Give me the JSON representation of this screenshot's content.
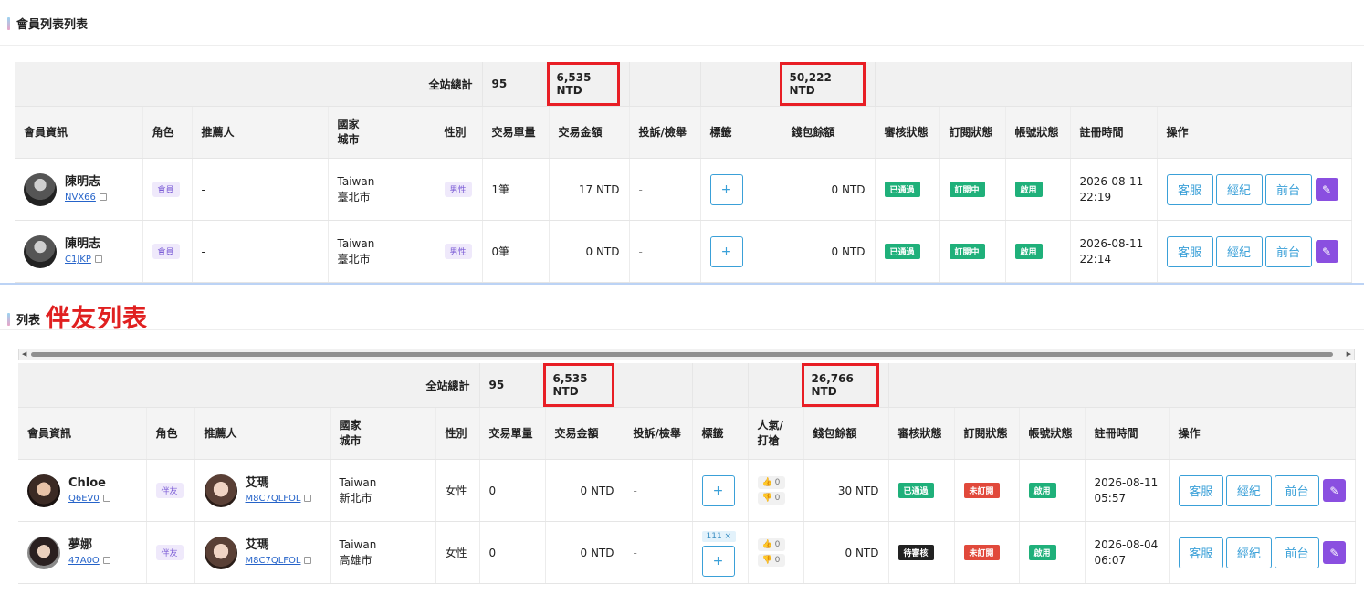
{
  "top_panel": {
    "title": "會員列表列表",
    "summary": {
      "label": "全站總計",
      "count": "95",
      "amount": "6,535 NTD",
      "wallet": "50,222 NTD"
    },
    "headers": {
      "member": "會員資訊",
      "role": "角色",
      "referrer": "推薦人",
      "country": "國家",
      "city": "城市",
      "gender": "性別",
      "tx_count": "交易單量",
      "tx_amount": "交易金額",
      "complaint": "投訴/檢舉",
      "tags": "標籤",
      "wallet": "錢包餘額",
      "review": "審核狀態",
      "subscription": "訂閱狀態",
      "account": "帳號狀態",
      "registered": "註冊時間",
      "actions": "操作"
    },
    "rows": [
      {
        "name": "陳明志",
        "code": "NVX66",
        "role": "會員",
        "referrer": "-",
        "country": "Taiwan",
        "city": "臺北市",
        "gender": "男性",
        "tx_count": "1筆",
        "tx_amount": "17 NTD",
        "complaint": "-",
        "wallet": "0 NTD",
        "review": "已通過",
        "subscription": "訂閱中",
        "account": "啟用",
        "date": "2026-08-11",
        "time": "22:19"
      },
      {
        "name": "陳明志",
        "code": "C1JKP",
        "role": "會員",
        "referrer": "-",
        "country": "Taiwan",
        "city": "臺北市",
        "gender": "男性",
        "tx_count": "0筆",
        "tx_amount": "0 NTD",
        "complaint": "-",
        "wallet": "0 NTD",
        "review": "已通過",
        "subscription": "訂閱中",
        "account": "啟用",
        "date": "2026-08-11",
        "time": "22:14"
      }
    ]
  },
  "bottom_panel": {
    "title": "列表",
    "big_title": "伴友列表",
    "summary": {
      "label": "全站總計",
      "count": "95",
      "amount": "6,535 NTD",
      "wallet": "26,766 NTD"
    },
    "headers": {
      "member": "會員資訊",
      "role": "角色",
      "referrer": "推薦人",
      "country": "國家",
      "city": "城市",
      "gender": "性別",
      "tx_count": "交易單量",
      "tx_amount": "交易金額",
      "complaint": "投訴/檢舉",
      "tags": "標籤",
      "popularity": "人氣/",
      "popularity2": "打槍",
      "wallet": "錢包餘額",
      "review": "審核狀態",
      "subscription": "訂閱狀態",
      "account": "帳號狀態",
      "registered": "註冊時間",
      "actions": "操作"
    },
    "rows": [
      {
        "name": "Chloe",
        "code": "Q6EV0",
        "role": "伴友",
        "ref_name": "艾瑪",
        "ref_code": "M8C7QLFOL",
        "country": "Taiwan",
        "city": "新北市",
        "gender": "女性",
        "tx_count": "0",
        "tx_amount": "0 NTD",
        "complaint": "-",
        "tag": "",
        "likes": "0",
        "dislikes": "0",
        "wallet": "30 NTD",
        "review": "已通過",
        "subscription": "未訂閱",
        "account": "啟用",
        "date": "2026-08-11",
        "time": "05:57"
      },
      {
        "name": "夢娜",
        "code": "47A0O",
        "role": "伴友",
        "ref_name": "艾瑪",
        "ref_code": "M8C7QLFOL",
        "country": "Taiwan",
        "city": "高雄市",
        "gender": "女性",
        "tx_count": "0",
        "tx_amount": "0 NTD",
        "complaint": "-",
        "tag": "111 ×",
        "likes": "0",
        "dislikes": "0",
        "wallet": "0 NTD",
        "review": "待審核",
        "subscription": "未訂閱",
        "account": "啟用",
        "date": "2026-08-04",
        "time": "06:07"
      }
    ]
  },
  "actions": {
    "service": "客服",
    "agent": "經紀",
    "front": "前台",
    "plus": "+",
    "like_icon": "👍",
    "dislike_icon": "👎"
  },
  "colors": {
    "highlight": "#e81e25",
    "accent": "#3aa0d8",
    "edit": "#8a4fe0",
    "green": "#1fb07a",
    "red": "#e1493b"
  }
}
